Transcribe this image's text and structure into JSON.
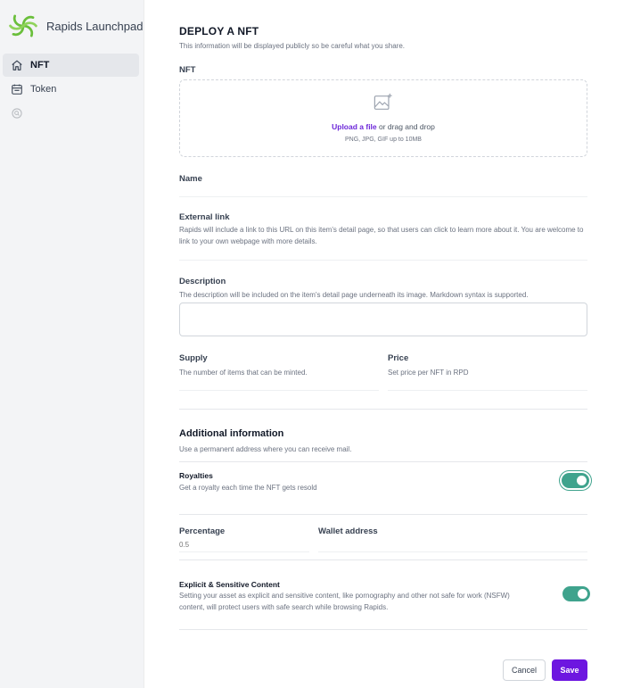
{
  "sidebar": {
    "brand_name": "Rapids Launchpad",
    "items": [
      {
        "label": "NFT",
        "icon": "home-icon",
        "active": true
      },
      {
        "label": "Token",
        "icon": "calendar-icon",
        "active": false
      },
      {
        "label": "",
        "icon": "search-icon",
        "active": false
      }
    ]
  },
  "colors": {
    "accent_purple": "#6d16e0",
    "toggle_green": "#3fa38d",
    "logo_green": "#6abf3b"
  },
  "form": {
    "title": "DEPLOY A NFT",
    "subtitle": "This information will be displayed publicly so be careful what you share.",
    "nft": {
      "label": "NFT",
      "upload_link": "Upload a file",
      "upload_text": " or drag and drop",
      "upload_hint": "PNG, JPG, GIF up to 10MB"
    },
    "name": {
      "label": "Name",
      "value": ""
    },
    "external_link": {
      "label": "External link",
      "help": "Rapids will include a link to this URL on this item's detail page, so that users can click to learn more about it. You are welcome to link to your own webpage with more details.",
      "value": ""
    },
    "description": {
      "label": "Description",
      "help": "The description will be included on the item's detail page underneath its image. Markdown syntax is supported.",
      "value": ""
    },
    "supply": {
      "label": "Supply",
      "help": "The number of items that can be minted.",
      "value": ""
    },
    "price": {
      "label": "Price",
      "help": "Set price per NFT in RPD",
      "value": ""
    },
    "additional": {
      "title": "Additional information",
      "help": "Use a permanent address where you can receive mail."
    },
    "royalties": {
      "label": "Royalties",
      "help": "Get a royalty each time the NFT gets resold",
      "enabled": true
    },
    "percentage": {
      "label": "Percentage",
      "placeholder": "0.5"
    },
    "wallet": {
      "label": "Wallet address",
      "value": ""
    },
    "explicit": {
      "label": "Explicit & Sensitive Content",
      "help": "Setting your asset as explicit and sensitive content, like pornography and other not safe for work (NSFW) content, will protect users with safe search while browsing Rapids.",
      "enabled": true
    },
    "actions": {
      "cancel": "Cancel",
      "save": "Save"
    }
  }
}
